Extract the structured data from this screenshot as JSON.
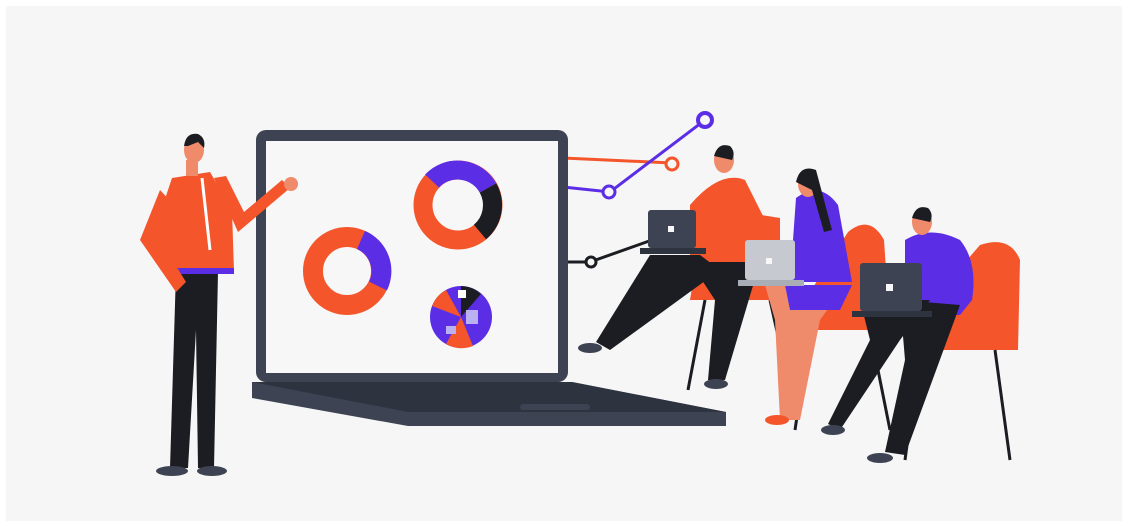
{
  "illustration": {
    "subject": "presenter-with-laptop-and-seated-audience",
    "palette": {
      "background": "#f6f6f6",
      "accent_orange": "#f4552b",
      "accent_purple": "#5b2ee6",
      "dark": "#1c1d22",
      "laptop_frame": "#3d4352",
      "skin": "#ef8a6b",
      "laptop_screen": "#f7f7f7"
    },
    "icons": [
      "presenter-figure",
      "laptop",
      "donut-chart",
      "pie-chart",
      "line-graph",
      "audience-person",
      "small-laptop",
      "chair"
    ]
  }
}
